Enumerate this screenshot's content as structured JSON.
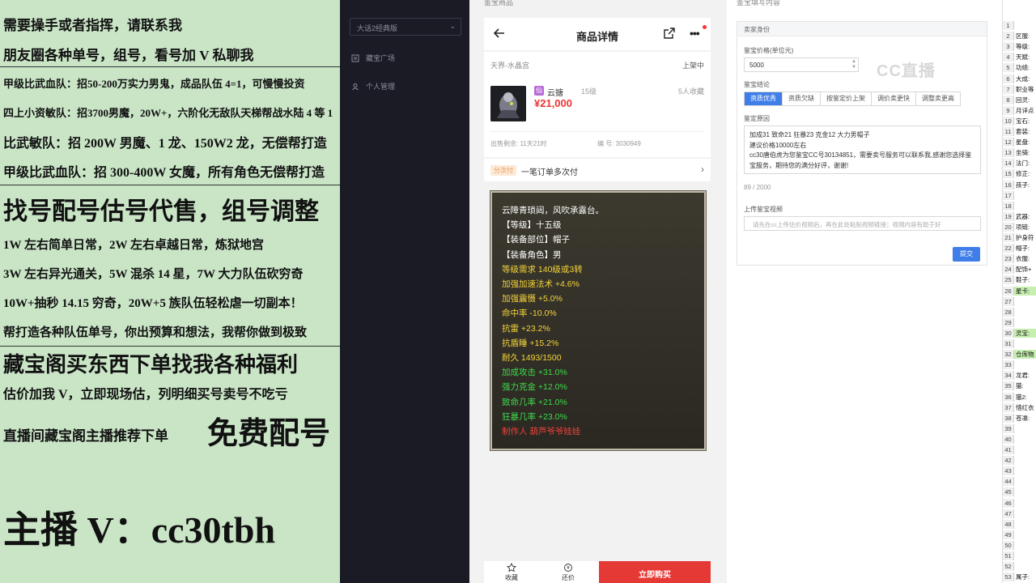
{
  "ad_panel": {
    "lines": [
      "需要操手或者指挥，请联系我",
      "朋友圈各种单号，组号，看号加 V 私聊我",
      "甲级比武血队：招50-200万实力男鬼，成品队伍 4=1，可慢慢投资",
      "四上小资敏队：招3700男魔，20W+，六阶化无敌队天梯帮战水陆 4 等 1",
      "比武敏队：招 200W 男魔、1 龙、150W2 龙，无偿帮打造",
      "甲级比武血队：招 300-400W 女魔，所有角色无偿帮打造",
      "找号配号估号代售，组号调整",
      "1W 左右简单日常，2W 左右卓越日常，炼狱地宫",
      "3W 左右异光通关，5W 混杀 14 星，7W 大力队伍砍穷奇",
      "10W+抽秒 14.15 穷奇，20W+5 族队伍轻松虐一切副本！",
      "帮打造各种队伍单号，你出预算和想法，我帮你做到极致",
      "藏宝阁买东西下单找我各种福利",
      "估价加我 V，立即现场估，列明细买号卖号不吃亏",
      "直播间藏宝阁主播推荐下单",
      "免费配号",
      "主播 V：cc30tbh"
    ]
  },
  "sidebar": {
    "select_value": "大话2经典版",
    "items": [
      "藏宝广场",
      "个人管理"
    ]
  },
  "phone": {
    "section_title": "鉴宝商品",
    "header_title": "商品详情",
    "server": "天界-水晶宫",
    "status": "上架中",
    "role_class": "云搪",
    "level": "15级",
    "favorites": "5人收藏",
    "price": "¥21,000",
    "time_left": "出售剩余: 11天21时",
    "item_no": "编 号: 3030949",
    "order_tag": "分次付",
    "order_text": "一笔订单多次付",
    "item_lines": [
      {
        "text": "云障青琐闼，风吹承露台。",
        "color": "#ffffff"
      },
      {
        "text": "【等级】十五级",
        "color": "#ffffff"
      },
      {
        "text": "【装备部位】帽子",
        "color": "#ffffff"
      },
      {
        "text": "【装备角色】男",
        "color": "#ffffff"
      },
      {
        "text": "等级需求 140级或3转",
        "color": "#f5d43a"
      },
      {
        "text": "加强加速法术 +4.6%",
        "color": "#f5d43a"
      },
      {
        "text": "加强震慑 +5.0%",
        "color": "#f5d43a"
      },
      {
        "text": "命中率 -10.0%",
        "color": "#f5d43a"
      },
      {
        "text": "抗雷 +23.2%",
        "color": "#f5d43a"
      },
      {
        "text": "抗盾睡 +15.2%",
        "color": "#f5d43a"
      },
      {
        "text": "耐久 1493/1500",
        "color": "#f5d43a"
      },
      {
        "text": "加成攻击 +31.0%",
        "color": "#3ddc4a"
      },
      {
        "text": "强力克金 +12.0%",
        "color": "#3ddc4a"
      },
      {
        "text": "致命几率 +21.0%",
        "color": "#3ddc4a"
      },
      {
        "text": "狂暴几率 +23.0%",
        "color": "#3ddc4a"
      },
      {
        "text": "制作人 葫芦爷爷娃娃",
        "color": "#f0413a"
      }
    ],
    "bottom": {
      "fav_label": "收藏",
      "bargain_label": "还价",
      "buy_label": "立即购买"
    }
  },
  "form": {
    "section_title": "鉴宝填写内容",
    "card_title": "卖家身份",
    "price_label": "鉴宝价格(单位元)",
    "price_value": "5000",
    "conclusion_label": "鉴宝结论",
    "options": [
      "资质优秀",
      "资质欠缺",
      "按鉴定价上架",
      "调价卖更快",
      "调整卖更高"
    ],
    "reason_label": "鉴定原因",
    "reason_lines": [
      "加成31 致命21 狂暴23 克金12 大力男帽子",
      "建议价格10000左右",
      "cc30唐伯虎为您鉴宝CC号30134851，需要卖号服务可以联系我,感谢您选择鉴宝服务，期待您的满分好评，谢谢!"
    ],
    "count": "89 / 2000",
    "video_label": "上传鉴宝视频",
    "video_placeholder": "请先在cc上传估价视频后，再在此处粘贴视频链接；视频内容有助于好",
    "submit_label": "提交",
    "watermark": "CC直播"
  },
  "sheet": {
    "rows": [
      {
        "n": "1",
        "t": ""
      },
      {
        "n": "2",
        "t": "区服:"
      },
      {
        "n": "3",
        "t": "等级:"
      },
      {
        "n": "4",
        "t": "天赋:"
      },
      {
        "n": "5",
        "t": "功绩:"
      },
      {
        "n": "6",
        "t": "大成:"
      },
      {
        "n": "7",
        "t": "职业等"
      },
      {
        "n": "8",
        "t": "回灵:"
      },
      {
        "n": "9",
        "t": "月详点"
      },
      {
        "n": "10",
        "t": "宝石:"
      },
      {
        "n": "11",
        "t": "套装:"
      },
      {
        "n": "12",
        "t": "星盘:"
      },
      {
        "n": "13",
        "t": "坐骑:"
      },
      {
        "n": "14",
        "t": "法门:"
      },
      {
        "n": "15",
        "t": "修正:"
      },
      {
        "n": "16",
        "t": "孩子:"
      },
      {
        "n": "17",
        "t": ""
      },
      {
        "n": "18",
        "t": ""
      },
      {
        "n": "19",
        "t": "武器:"
      },
      {
        "n": "20",
        "t": "项链:"
      },
      {
        "n": "21",
        "t": "护身符"
      },
      {
        "n": "22",
        "t": "帽子:"
      },
      {
        "n": "23",
        "t": "衣服:"
      },
      {
        "n": "24",
        "t": "配饰+"
      },
      {
        "n": "25",
        "t": "鞋子:"
      },
      {
        "n": "26",
        "t": "星卡:"
      },
      {
        "n": "27",
        "t": ""
      },
      {
        "n": "28",
        "t": ""
      },
      {
        "n": "29",
        "t": ""
      },
      {
        "n": "30",
        "t": "灵宝:"
      },
      {
        "n": "31",
        "t": ""
      },
      {
        "n": "32",
        "t": "仓库物"
      },
      {
        "n": "33",
        "t": ""
      },
      {
        "n": "34",
        "t": "龙君:"
      },
      {
        "n": "35",
        "t": "猫:"
      },
      {
        "n": "36",
        "t": "猫2:"
      },
      {
        "n": "37",
        "t": "惜红衣"
      },
      {
        "n": "38",
        "t": "苍凛:"
      },
      {
        "n": "39",
        "t": ""
      },
      {
        "n": "40",
        "t": ""
      },
      {
        "n": "41",
        "t": ""
      },
      {
        "n": "42",
        "t": ""
      },
      {
        "n": "43",
        "t": ""
      },
      {
        "n": "44",
        "t": ""
      },
      {
        "n": "45",
        "t": ""
      },
      {
        "n": "46",
        "t": ""
      },
      {
        "n": "47",
        "t": ""
      },
      {
        "n": "48",
        "t": ""
      },
      {
        "n": "49",
        "t": ""
      },
      {
        "n": "50",
        "t": ""
      },
      {
        "n": "51",
        "t": ""
      },
      {
        "n": "52",
        "t": ""
      },
      {
        "n": "53",
        "t": "属子:"
      }
    ],
    "highlight_color": "#c6efb0"
  }
}
